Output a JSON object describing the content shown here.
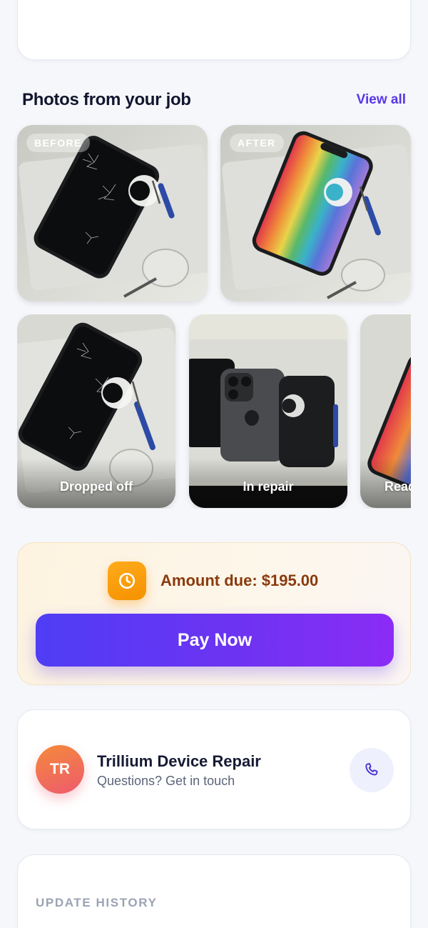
{
  "photos_section": {
    "title": "Photos from your job",
    "view_all": "View all"
  },
  "comparison": {
    "before_label": "BEFORE",
    "after_label": "AFTER"
  },
  "timeline": [
    {
      "caption": "Dropped off"
    },
    {
      "caption": "In repair"
    },
    {
      "caption": "Ready"
    }
  ],
  "payment": {
    "amount_text": "Amount due: $195.00",
    "button_label": "Pay Now",
    "icon": "clock-icon"
  },
  "contact": {
    "initials": "TR",
    "name": "Trillium Device Repair",
    "subtitle": "Questions? Get in touch",
    "icon": "phone-icon"
  },
  "history": {
    "label": "UPDATE HISTORY"
  },
  "colors": {
    "accent": "#5a35e8",
    "amount_text": "#8a3a0d",
    "clock_badge": "#f59100",
    "avatar": "#ee5a6e"
  }
}
